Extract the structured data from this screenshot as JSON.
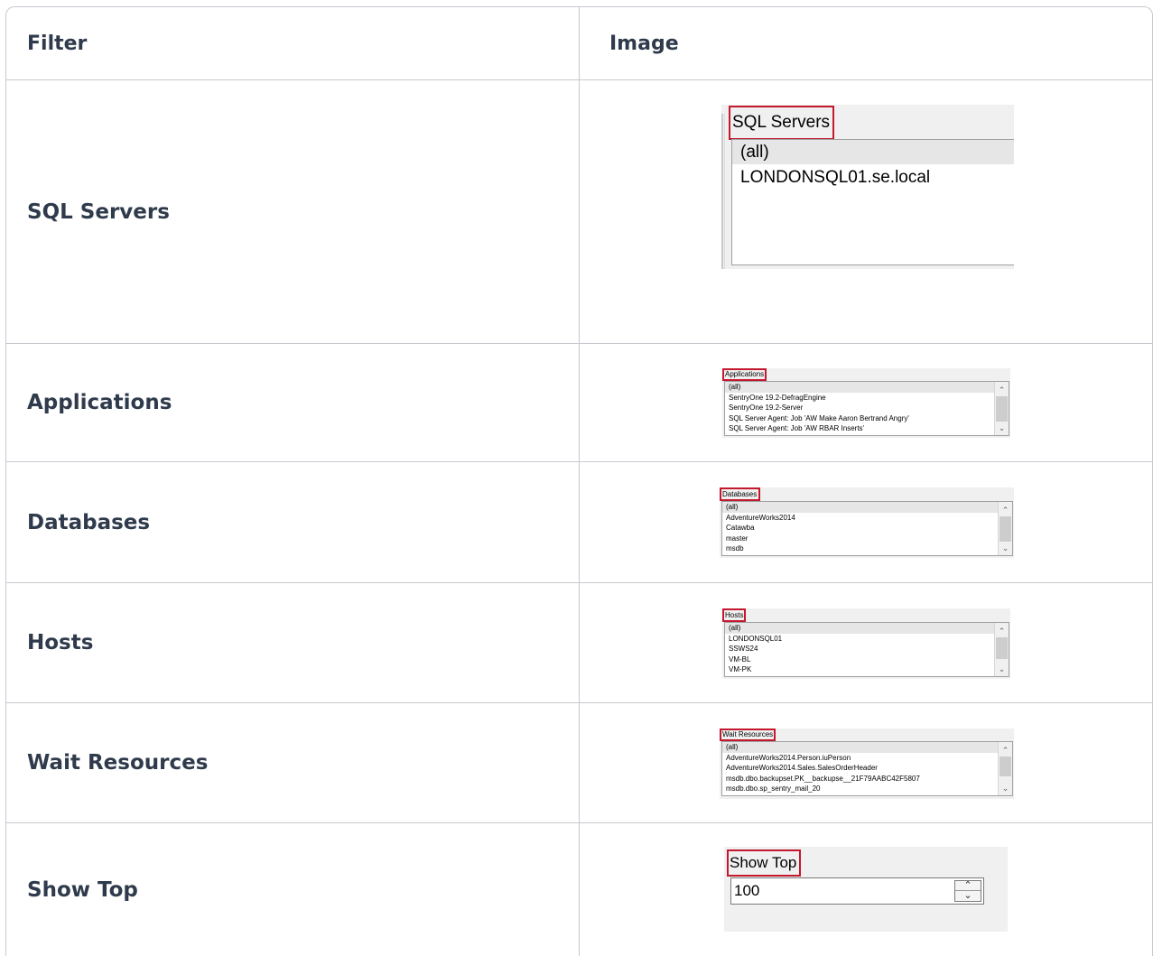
{
  "headers": {
    "filter": "Filter",
    "image": "Image"
  },
  "rows": [
    {
      "label": "SQL Servers",
      "widget": {
        "caption": "SQL Servers",
        "items": [
          "(all)",
          "LONDONSQL01.se.local"
        ]
      }
    },
    {
      "label": "Applications",
      "widget": {
        "caption": "Applications",
        "items": [
          "(all)",
          "SentryOne 19.2-DefragEngine",
          "SentryOne 19.2-Server",
          "SQL Server Agent: Job 'AW Make Aaron Bertrand Angry'",
          "SQL Server Agent: Job 'AW RBAR Inserts'"
        ]
      }
    },
    {
      "label": "Databases",
      "widget": {
        "caption": "Databases",
        "items": [
          "(all)",
          "AdventureWorks2014",
          "Catawba",
          "master",
          "msdb"
        ]
      }
    },
    {
      "label": "Hosts",
      "widget": {
        "caption": "Hosts",
        "items": [
          "(all)",
          "LONDONSQL01",
          "SSWS24",
          "VM-BL",
          "VM-PK"
        ]
      }
    },
    {
      "label": "Wait Resources",
      "widget": {
        "caption": "Wait Resources",
        "items": [
          "(all)",
          "AdventureWorks2014.Person.iuPerson",
          "AdventureWorks2014.Sales.SalesOrderHeader",
          "msdb.dbo.backupset.PK__backupse__21F79AABC42F5807",
          "msdb.dbo.sp_sentry_mail_20"
        ]
      }
    },
    {
      "label": "Show Top",
      "widget": {
        "caption": "Show Top",
        "value": "100"
      }
    }
  ],
  "colors": {
    "highlight": "#c3182e",
    "border": "#c5c9ce",
    "label_text": "#2f3b4c"
  },
  "icons": {
    "scroll_up": "chevron-up-icon",
    "scroll_down": "chevron-down-icon",
    "spin_up": "spin-up-icon",
    "spin_down": "spin-down-icon"
  }
}
